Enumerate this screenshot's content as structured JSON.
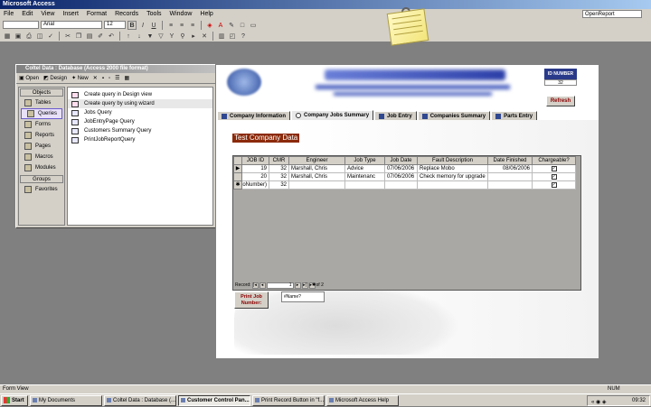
{
  "app": {
    "title": "Microsoft Access",
    "help_box": "OpenReport"
  },
  "menu": [
    "File",
    "Edit",
    "View",
    "Insert",
    "Format",
    "Records",
    "Tools",
    "Window",
    "Help"
  ],
  "toolbar": {
    "font_name": "Arial",
    "font_size": "12"
  },
  "db_window": {
    "title": "Coltel Data : Database (Access 2000 file format)",
    "open": "Open",
    "design": "Design",
    "new": "New",
    "objects_header": "Objects",
    "objects": [
      "Tables",
      "Queries",
      "Forms",
      "Reports",
      "Pages",
      "Macros",
      "Modules"
    ],
    "groups_header": "Groups",
    "favorites": "Favorites",
    "list": [
      "Create query in Design view",
      "Create query by using wizard",
      "Jobs Query",
      "JobEntryPage Query",
      "Customers Summary Query",
      "PrintJobReportQuery"
    ]
  },
  "form": {
    "id_label": "ID NUMBER",
    "id_value": "32",
    "refresh": "Refresh",
    "tabs": [
      "Company Information",
      "Company Jobs Summary",
      "Job Entry",
      "Companies Summary",
      "Parts Entry"
    ],
    "company_title": "Test Company Data",
    "columns": [
      "JOB ID",
      "CMR",
      "Engineer",
      "Job Type",
      "Job Date",
      "Fault Description",
      "Date Finished",
      "Chargeable?"
    ],
    "rows": [
      {
        "job_id": "19",
        "cmr": "32",
        "engineer": "Marshall, Chris",
        "job_type": "Advice",
        "job_date": "07/06/2006",
        "fault": "Replace Mobo",
        "finished": "08/06/2006",
        "charge": "✓"
      },
      {
        "job_id": "20",
        "cmr": "32",
        "engineer": "Marshall, Chris",
        "job_type": "Maintenanc",
        "job_date": "07/06/2006",
        "fault": "Check memory for upgrade",
        "finished": "",
        "charge": "✓"
      },
      {
        "job_id": "(AutoNumber)",
        "cmr": "32",
        "engineer": "",
        "job_type": "",
        "job_date": "",
        "fault": "",
        "finished": "",
        "charge": "✓"
      }
    ],
    "record_label": "Record:",
    "record_current": "1",
    "record_of": "of 2",
    "print_button": "Print Job Number:",
    "name_field": "#Name?"
  },
  "status": {
    "left": "Form View",
    "num": "NUM"
  },
  "taskbar": {
    "start": "Start",
    "tasks": [
      "My Documents",
      "Coltel Data : Database (...",
      "Customer Control Pan...",
      "Print Record Button in \"f...",
      "Microsoft Access Help"
    ],
    "clock": "09:32"
  }
}
